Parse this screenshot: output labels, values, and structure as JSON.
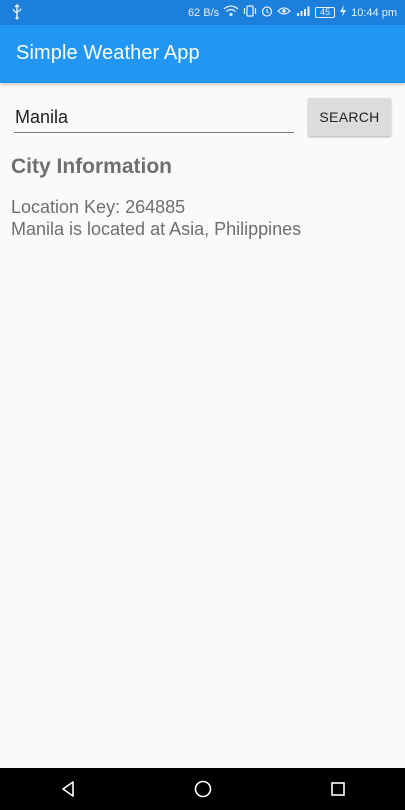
{
  "status_bar": {
    "network_speed": "62 B/s",
    "battery": "45",
    "time": "10:44 pm",
    "icons": [
      "usb-icon",
      "wifi-icon",
      "vibrate-icon",
      "alarm-icon",
      "eye-icon",
      "signal-icon",
      "charging-icon"
    ]
  },
  "app_bar": {
    "title": "Simple Weather App",
    "color": "#2196f3"
  },
  "search": {
    "value": "Manila",
    "button_label": "SEARCH"
  },
  "city_info": {
    "heading": "City Information",
    "location_key_line": "Location Key: 264885",
    "location_line": "Manila is located at Asia, Philippines"
  },
  "nav_bar": {
    "icons": [
      "back-icon",
      "home-icon",
      "recents-icon"
    ]
  }
}
